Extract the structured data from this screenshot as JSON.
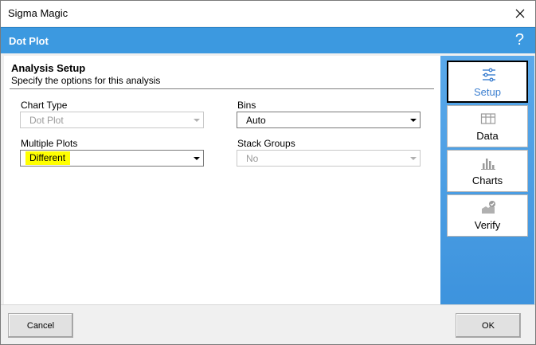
{
  "window": {
    "title": "Sigma Magic"
  },
  "header": {
    "title": "Dot Plot",
    "help": "?"
  },
  "section": {
    "title": "Analysis Setup",
    "subtitle": "Specify the options for this analysis"
  },
  "fields": {
    "chart_type": {
      "label": "Chart Type",
      "value": "Dot Plot",
      "enabled": false
    },
    "bins": {
      "label": "Bins",
      "value": "Auto",
      "enabled": true
    },
    "multiple_plots": {
      "label": "Multiple Plots",
      "value": "Different",
      "enabled": true,
      "highlight_color": "#ffff00"
    },
    "stack_groups": {
      "label": "Stack Groups",
      "value": "No",
      "enabled": false
    }
  },
  "sidebar": {
    "items": [
      {
        "label": "Setup",
        "icon": "sliders-icon",
        "active": true
      },
      {
        "label": "Data",
        "icon": "grid-icon",
        "active": false
      },
      {
        "label": "Charts",
        "icon": "bar-chart-icon",
        "active": false
      },
      {
        "label": "Verify",
        "icon": "verify-icon",
        "active": false
      }
    ]
  },
  "footer": {
    "cancel": "Cancel",
    "ok": "OK"
  },
  "colors": {
    "accent": "#3c99e0",
    "sidebar": "#4a9ee6"
  }
}
